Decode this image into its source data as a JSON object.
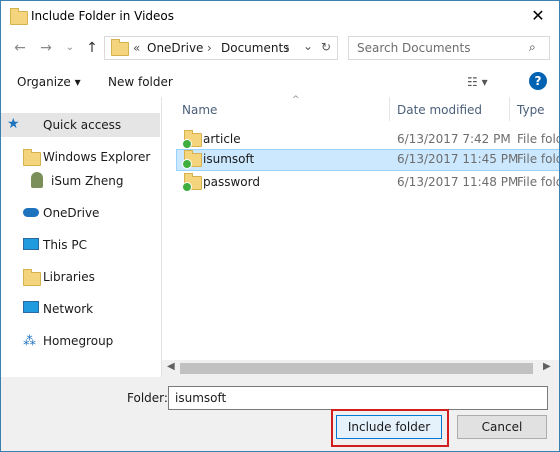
{
  "window": {
    "title": "Include Folder in Videos",
    "close_glyph": "✕"
  },
  "nav": {
    "back": "←",
    "forward": "→",
    "recent": "⌄",
    "up": "↑",
    "breadcrumb": [
      "«",
      "OneDrive",
      "›",
      "Documents",
      "›"
    ],
    "dropdown": "⌄",
    "refresh": "↻",
    "search_placeholder": "Search Documents"
  },
  "toolbar": {
    "organize": "Organize ▾",
    "new_folder": "New folder",
    "view_glyph": "☷ ▾",
    "help": "?"
  },
  "sidebar": {
    "items": [
      {
        "label": "Quick access",
        "icon": "star-icon"
      },
      {
        "label": "Windows Explorer",
        "icon": "folder-icon"
      },
      {
        "label": "iSum Zheng",
        "icon": "user-icon"
      },
      {
        "label": "OneDrive",
        "icon": "cloud-icon"
      },
      {
        "label": "This PC",
        "icon": "computer-icon"
      },
      {
        "label": "Libraries",
        "icon": "library-icon"
      },
      {
        "label": "Network",
        "icon": "network-icon"
      },
      {
        "label": "Homegroup",
        "icon": "homegroup-icon"
      }
    ]
  },
  "columns": {
    "name": "Name",
    "date": "Date modified",
    "type": "Type"
  },
  "files": [
    {
      "name": "article",
      "date": "6/13/2017 7:42 PM",
      "type": "File fold"
    },
    {
      "name": "isumsoft",
      "date": "6/13/2017 11:45 PM",
      "type": "File fold"
    },
    {
      "name": "password",
      "date": "6/13/2017 11:48 PM",
      "type": "File fold"
    }
  ],
  "footer": {
    "folder_label": "Folder:",
    "folder_value": "isumsoft",
    "include_button": "Include folder",
    "cancel_button": "Cancel"
  },
  "colors": {
    "accent": "#0078d7",
    "selection": "#cce8ff",
    "highlight": "#d11d1d"
  }
}
